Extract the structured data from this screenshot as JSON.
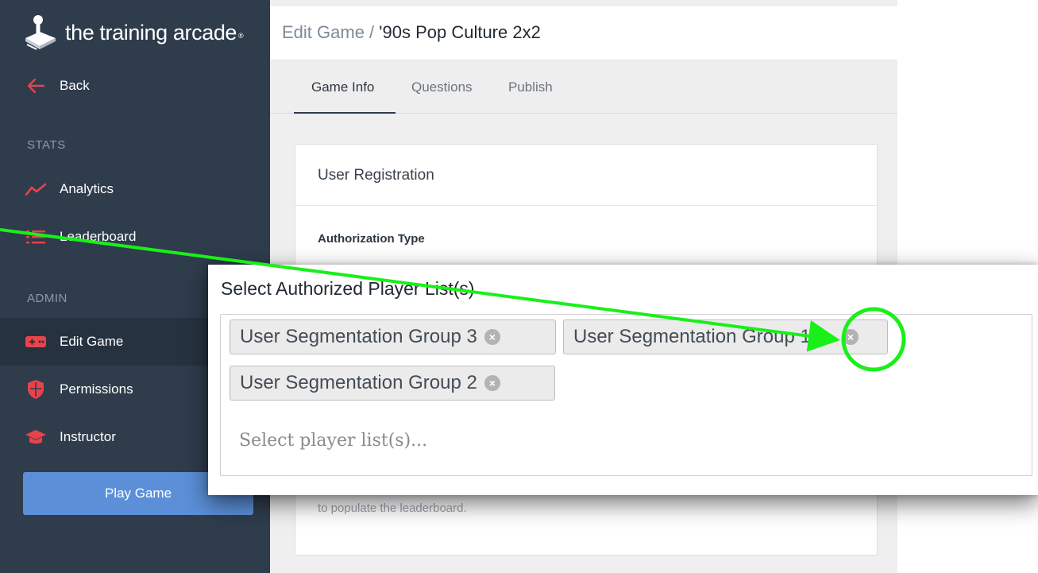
{
  "brand": {
    "name": "the training arcade",
    "tm": "®"
  },
  "sidebar": {
    "back_label": "Back",
    "section_stats": "STATS",
    "section_admin": "ADMIN",
    "items": [
      {
        "label": "Analytics",
        "icon": "trend-line-icon"
      },
      {
        "label": "Leaderboard",
        "icon": "list-icon"
      },
      {
        "label": "Edit Game",
        "icon": "gamepad-icon"
      },
      {
        "label": "Permissions",
        "icon": "shield-icon"
      },
      {
        "label": "Instructor",
        "icon": "graduation-cap-icon"
      }
    ],
    "play_button": "Play Game"
  },
  "header": {
    "breadcrumb_parent": "Edit Game",
    "breadcrumb_sep": " / ",
    "breadcrumb_current": "'90s Pop Culture 2x2"
  },
  "tabs": [
    "Game Info",
    "Questions",
    "Publish"
  ],
  "card": {
    "title": "User Registration",
    "auth_label": "Authorization Type",
    "help_text": "to populate the leaderboard."
  },
  "zoom": {
    "title": "Select Authorized Player List(s)",
    "chips": [
      "User Segmentation Group 3",
      "User Segmentation Group 1",
      "User Segmentation Group 2"
    ],
    "placeholder": "Select player list(s)..."
  },
  "colors": {
    "sidebar_bg": "#2e3c4c",
    "accent_red": "#e8434b",
    "play_button": "#5b8fd8",
    "annotation_green": "#1aef1a"
  }
}
